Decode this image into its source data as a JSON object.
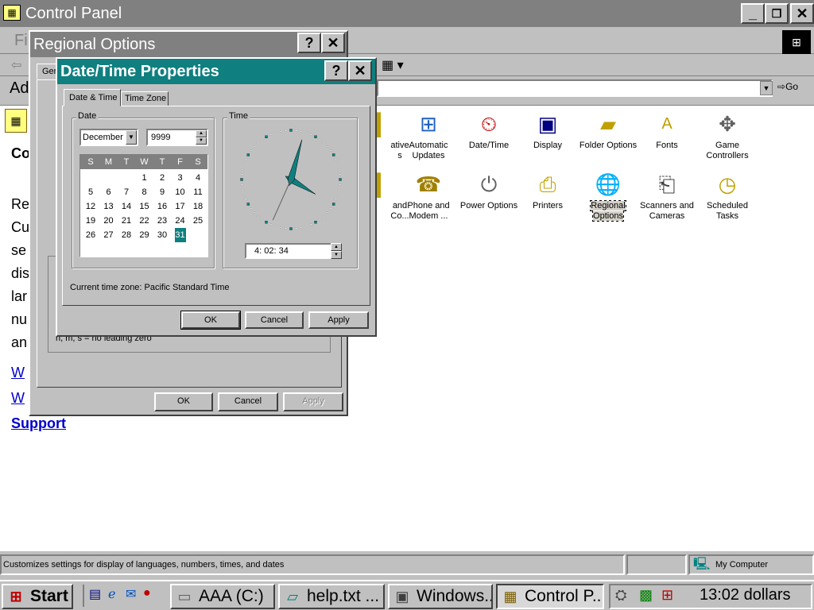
{
  "control_panel": {
    "title": "Control Panel",
    "menu_partial": "Fi",
    "address_partial": "Ad",
    "go_label": "Go",
    "left_partial": {
      "heading": "Co",
      "lines": [
        "Re",
        "Cu",
        "se",
        "dis",
        "lar",
        "nu",
        "an"
      ],
      "links": [
        "W",
        "W",
        "Support"
      ]
    },
    "icons_row1": [
      {
        "label": "ative\ns",
        "icon": "partial-icon"
      },
      {
        "label": "Automatic\nUpdates",
        "icon": "windows-update-icon"
      },
      {
        "label": "Date/Time",
        "icon": "calendar-clock-icon"
      },
      {
        "label": "Display",
        "icon": "display-icon"
      },
      {
        "label": "Folder Options",
        "icon": "folder-options-icon"
      },
      {
        "label": "Fonts",
        "icon": "fonts-icon"
      },
      {
        "label": "Game\nControllers",
        "icon": "joystick-icon"
      }
    ],
    "icons_row2": [
      {
        "label": "and\nCo...",
        "icon": "partial-icon"
      },
      {
        "label": "Phone and\nModem ...",
        "icon": "phone-icon"
      },
      {
        "label": "Power Options",
        "icon": "power-icon"
      },
      {
        "label": "Printers",
        "icon": "printer-icon"
      },
      {
        "label": "Regional\nOptions",
        "icon": "globe-icon"
      },
      {
        "label": "Scanners and\nCameras",
        "icon": "scanner-icon"
      },
      {
        "label": "Scheduled\nTasks",
        "icon": "scheduled-tasks-icon"
      }
    ],
    "status_text": "Customizes settings for display of languages, numbers, times, and dates",
    "status_zone": "My Computer"
  },
  "regional_options": {
    "title": "Regional Options",
    "tab_partial": "Ger",
    "partial_note": "h, m, s = no leading zero",
    "ok": "OK",
    "cancel": "Cancel",
    "apply": "Apply"
  },
  "datetime": {
    "title": "Date/Time Properties",
    "tabs": [
      "Date & Time",
      "Time Zone"
    ],
    "date_group": "Date",
    "time_group": "Time",
    "month": "December",
    "year": "9999",
    "day_headers": [
      "S",
      "M",
      "T",
      "W",
      "T",
      "F",
      "S"
    ],
    "weeks": [
      [
        "",
        "",
        "",
        "1",
        "2",
        "3",
        "4"
      ],
      [
        "5",
        "6",
        "7",
        "8",
        "9",
        "10",
        "11"
      ],
      [
        "12",
        "13",
        "14",
        "15",
        "16",
        "17",
        "18"
      ],
      [
        "19",
        "20",
        "21",
        "22",
        "23",
        "24",
        "25"
      ],
      [
        "26",
        "27",
        "28",
        "29",
        "30",
        "31",
        ""
      ]
    ],
    "selected_day": "31",
    "time_value": "4: 02: 34",
    "clock": {
      "hour": 4,
      "minute": 2,
      "second": 34
    },
    "timezone_text": "Current time zone:  Pacific Standard Time",
    "ok": "OK",
    "cancel": "Cancel",
    "apply": "Apply"
  },
  "taskbar": {
    "start": "Start",
    "buttons": [
      {
        "label": "AAA (C:)",
        "icon": "drive-icon"
      },
      {
        "label": "help.txt ...",
        "icon": "notepad-icon"
      },
      {
        "label": "Windows...",
        "icon": "computer-icon"
      },
      {
        "label": "Control P...",
        "icon": "control-panel-icon"
      }
    ],
    "clock": "13:02 dollars"
  },
  "colors": {
    "active_title": "#0f7f7f",
    "inactive_title": "#808080",
    "face": "#c0c0c0",
    "link": "#0000cc"
  }
}
